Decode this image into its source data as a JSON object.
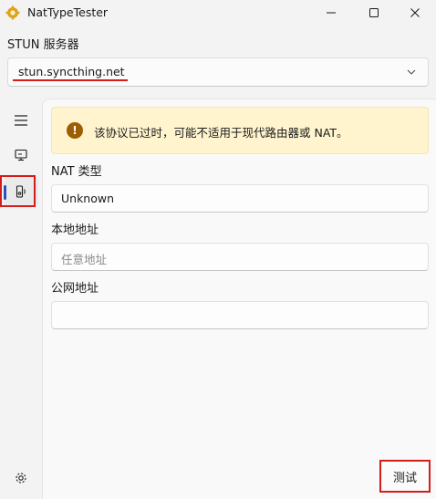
{
  "window": {
    "title": "NatTypeTester",
    "controls": [
      "minimize-icon",
      "maximize-icon",
      "close-icon"
    ]
  },
  "stun": {
    "label": "STUN 服务器",
    "value": "stun.syncthing.net"
  },
  "nav": {
    "items": [
      "menu-icon",
      "monitor-icon",
      "speaker-icon",
      "settings-icon"
    ],
    "selected": "speaker-icon"
  },
  "warning": {
    "text": "该协议已过时，可能不适用于现代路由器或 NAT。"
  },
  "fields": {
    "nat_type": {
      "label": "NAT 类型",
      "value": "Unknown"
    },
    "local_address": {
      "label": "本地地址",
      "placeholder": "任意地址"
    },
    "public_address": {
      "label": "公网地址",
      "value": ""
    }
  },
  "actions": {
    "test_label": "测试"
  },
  "colors": {
    "accent": "#2a52b6",
    "highlight": "#d31c1c",
    "warning_bg": "#fff4ce",
    "warning_icon": "#9d5d00"
  }
}
